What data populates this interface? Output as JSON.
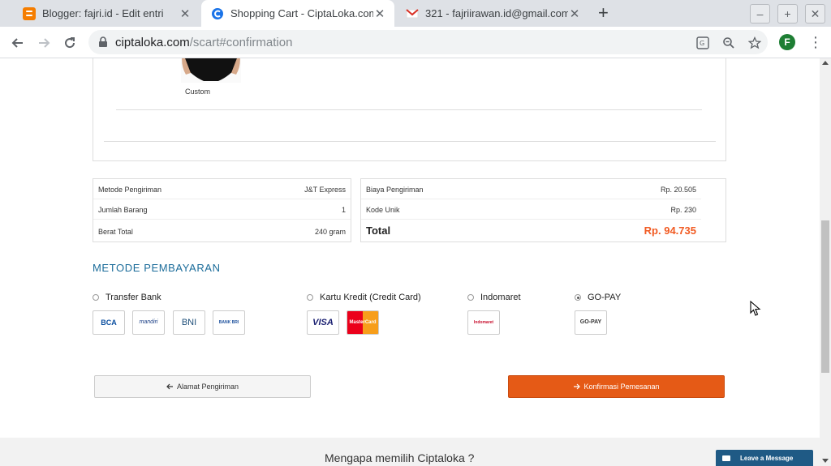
{
  "browser": {
    "tabs": [
      {
        "title": "Blogger: fajri.id - Edit entri",
        "favicon_color": "#f57d00"
      },
      {
        "title": "Shopping Cart - CiptaLoka.com",
        "favicon_color": "#1a73e8"
      },
      {
        "title": "321 - fajriirawan.id@gmail.com",
        "favicon_color": "#d93025"
      }
    ],
    "url_host": "ciptaloka.com",
    "url_path": "/scart#confirmation",
    "avatar_letter": "F",
    "window_controls": {
      "minimize": "–",
      "restore": "+",
      "close": "✕"
    }
  },
  "cart": {
    "product_label": "Custom"
  },
  "shipping_summary": [
    {
      "label": "Metode Pengiriman",
      "value": "J&T Express"
    },
    {
      "label": "Jumlah Barang",
      "value": "1"
    },
    {
      "label": "Berat Total",
      "value": "240 gram"
    }
  ],
  "cost_summary": [
    {
      "label": "Biaya Pengiriman",
      "value": "Rp. 20.505"
    },
    {
      "label": "Kode Unik",
      "value": "Rp. 230"
    }
  ],
  "total": {
    "label": "Total",
    "value": "Rp. 94.735"
  },
  "payment": {
    "section_title": "METODE PEMBAYARAN",
    "methods": [
      {
        "label": "Transfer Bank",
        "selected": false,
        "logos": [
          "BCA",
          "mandiri",
          "BNI",
          "BANK BRI"
        ]
      },
      {
        "label": "Kartu Kredit (Credit Card)",
        "selected": false,
        "logos": [
          "VISA",
          "MasterCard"
        ]
      },
      {
        "label": "Indomaret",
        "selected": false,
        "logos": [
          "Indomaret"
        ]
      },
      {
        "label": "GO-PAY",
        "selected": true,
        "logos": [
          "GO-PAY"
        ]
      }
    ]
  },
  "actions": {
    "back_label": "Alamat Pengiriman",
    "confirm_label": "Konfirmasi Pemesanan"
  },
  "footer": {
    "why_title": "Mengapa memilih Ciptaloka ?",
    "chat_label": "Leave a Message"
  },
  "colors": {
    "accent": "#e55a16",
    "total": "#f15a22",
    "section_title": "#1b6c9a",
    "chat": "#1f5a85"
  }
}
